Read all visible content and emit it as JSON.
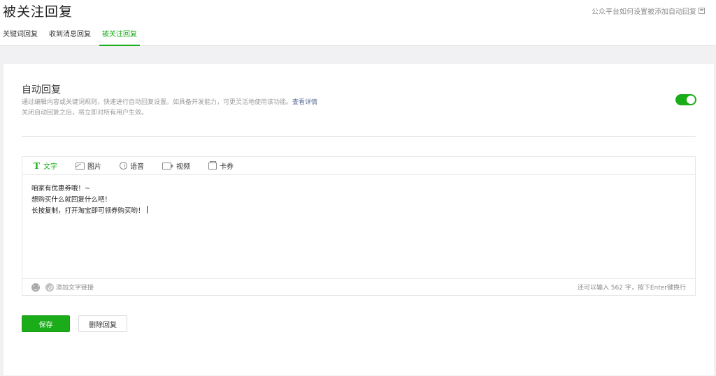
{
  "header": {
    "title": "被关注回复",
    "help_link": "公众平台如何设置被添加自动回复"
  },
  "tabs": [
    {
      "label": "关键词回复",
      "active": false
    },
    {
      "label": "收到消息回复",
      "active": false
    },
    {
      "label": "被关注回复",
      "active": true
    }
  ],
  "section": {
    "title": "自动回复",
    "desc_line1": "通过编辑内容或关键词规则，快速进行自动回复设置。如具备开发能力，可更灵活地使用该功能。",
    "desc_link": "查看详情",
    "desc_line2": "关闭自动回复之后，将立即对所有用户生效。",
    "toggle_on": true
  },
  "editor": {
    "types": [
      {
        "label": "文字",
        "icon": "text-icon",
        "active": true
      },
      {
        "label": "图片",
        "icon": "image-icon",
        "active": false
      },
      {
        "label": "语音",
        "icon": "voice-icon",
        "active": false
      },
      {
        "label": "视频",
        "icon": "video-icon",
        "active": false
      },
      {
        "label": "卡券",
        "icon": "card-icon",
        "active": false
      }
    ],
    "content_lines": [
      "咱家有优惠券哦！~",
      "想购买什么就回复什么吧！",
      "长按复制，打开淘宝即可领券购买哟！"
    ],
    "add_link_label": "添加文字链接",
    "counter_text": "还可以输入 562 字，按下Enter键换行"
  },
  "actions": {
    "save_label": "保存",
    "delete_label": "删除回复"
  },
  "colors": {
    "accent": "#1aad19",
    "link": "#576b95"
  }
}
